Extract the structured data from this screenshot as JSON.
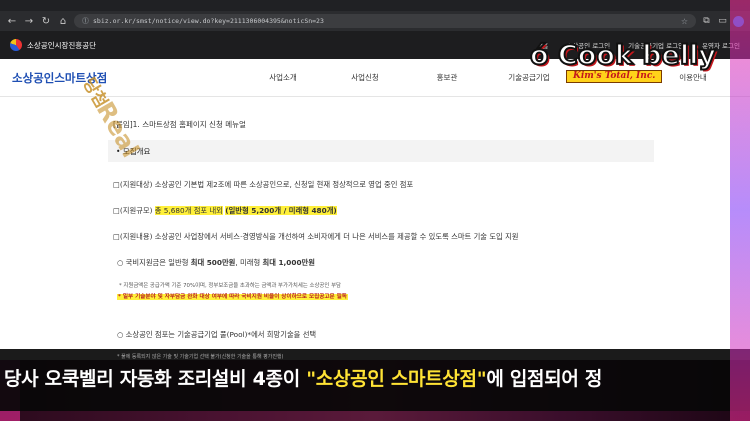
{
  "browser": {
    "url": "sbiz.or.kr/smst/notice/view.do?key=2111306004395&noticSn=23",
    "nav_icons": [
      "back-icon",
      "forward-icon",
      "reload-icon",
      "home-icon"
    ],
    "toolbar_icons": [
      "star-icon",
      "extensions-icon",
      "sidebar-icon"
    ]
  },
  "site": {
    "org_name": "소상공인시장진흥공단",
    "top_links": [
      "홈",
      "소상공인 로그인",
      "기술공급기업 로그인",
      "운영자 로그인"
    ],
    "logo": "소상공인스마트상점",
    "menu": [
      "사업소개",
      "사업신청",
      "홍보관",
      "기술공급기업",
      "",
      "이용안내"
    ]
  },
  "content": {
    "breadcrumb": "[붙임]1. 스마트상점 홈페이지 신청 메뉴얼",
    "section_title": "• 모집개요",
    "line1": "□(지원대상) 소상공인 기본법 제2조에 따른 소상공인으로, 신청일 현재 정상적으로 영업 중인 점포",
    "line2_prefix": "□(지원규모) ",
    "line2_hl1": "총 5,680개 점포 내외",
    "line2_hl2": "(일반형 5,200개 / 미래형 480개)",
    "line3": "□(지원내용) 소상공인 사업장에서 서비스·경영방식을 개선하여 소비자에게 더 나은 서비스를 제공할 수 있도록 스마트 기술 도입 지원",
    "line4_prefix": "○ 국비지원금은 일반형 ",
    "line4_b1": "최대 500만원",
    "line4_mid": ", 미래형 ",
    "line4_b2": "최대 1,000만원",
    "note1": "* 지원금액은 공급가액 기준 70%이며, 정부보조금을 초과하는 금액과 부가가치세는 소상공인 부담",
    "note2": "* 일부 기술분야 및 자부담금 완화 대상 여부에 따라 국비지원 비율이 상이하므로 모집공고문 필독",
    "line5": "○ 소상공인 점포는 기술공급기업 풀(Pool)*에서 희망기술을 선택",
    "note3": "* 풀에 등록되지 않은 기술 및 기술기업 선택 불가(신청한 기술을 통해 평가진행)"
  },
  "overlay": {
    "stamp1": "당첨",
    "stamp2": "Real",
    "brand_main": "ó Cook belly",
    "brand_sub": "Kim's Total, Inc.",
    "caption_part1": "당사 오쿡벨리 자동화 조리설비 4종이 ",
    "caption_quote": "\"소상공인 스마트상점\"",
    "caption_part2": "에 입점되어 정"
  }
}
